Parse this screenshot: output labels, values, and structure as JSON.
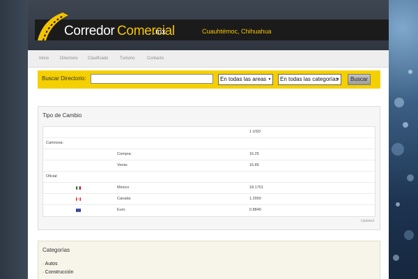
{
  "brand": {
    "name_part1": "Corredor",
    "name_part2": "Comercial",
    "tld": ".mx",
    "city": "Cuauhtémoc, Chihuahua",
    "accent_color": "#f5c400"
  },
  "nav": {
    "items": [
      "Inicio",
      "Directorio",
      "Clasificado",
      "Turismo",
      "Contacto"
    ]
  },
  "search": {
    "label": "Buscar Directorio:",
    "input_value": "",
    "area_select": "En todas las areas",
    "category_select": "En todas las categorías",
    "button_label": "Buscar"
  },
  "exchange": {
    "title": "Tipo de Cambio",
    "header_unit": "1 USD",
    "casas_label": "Camnosa:",
    "compra_label": "Compra:",
    "compra_value": "16.25",
    "venta_label": "Venta:",
    "venta_value": "16.85",
    "oficial_label": "Oficial:",
    "official_rates": [
      {
        "country": "México",
        "value": "18.1701",
        "flag_icon": "mexico-flag-icon"
      },
      {
        "country": "Canada",
        "value": "1.2950",
        "flag_icon": "canada-flag-icon"
      },
      {
        "country": "Euro",
        "value": "0.8849",
        "flag_icon": "eu-flag-icon"
      }
    ],
    "updated_label": "Updated"
  },
  "categories": {
    "title": "Categorías",
    "items": [
      "Autos",
      "Construcción"
    ]
  }
}
